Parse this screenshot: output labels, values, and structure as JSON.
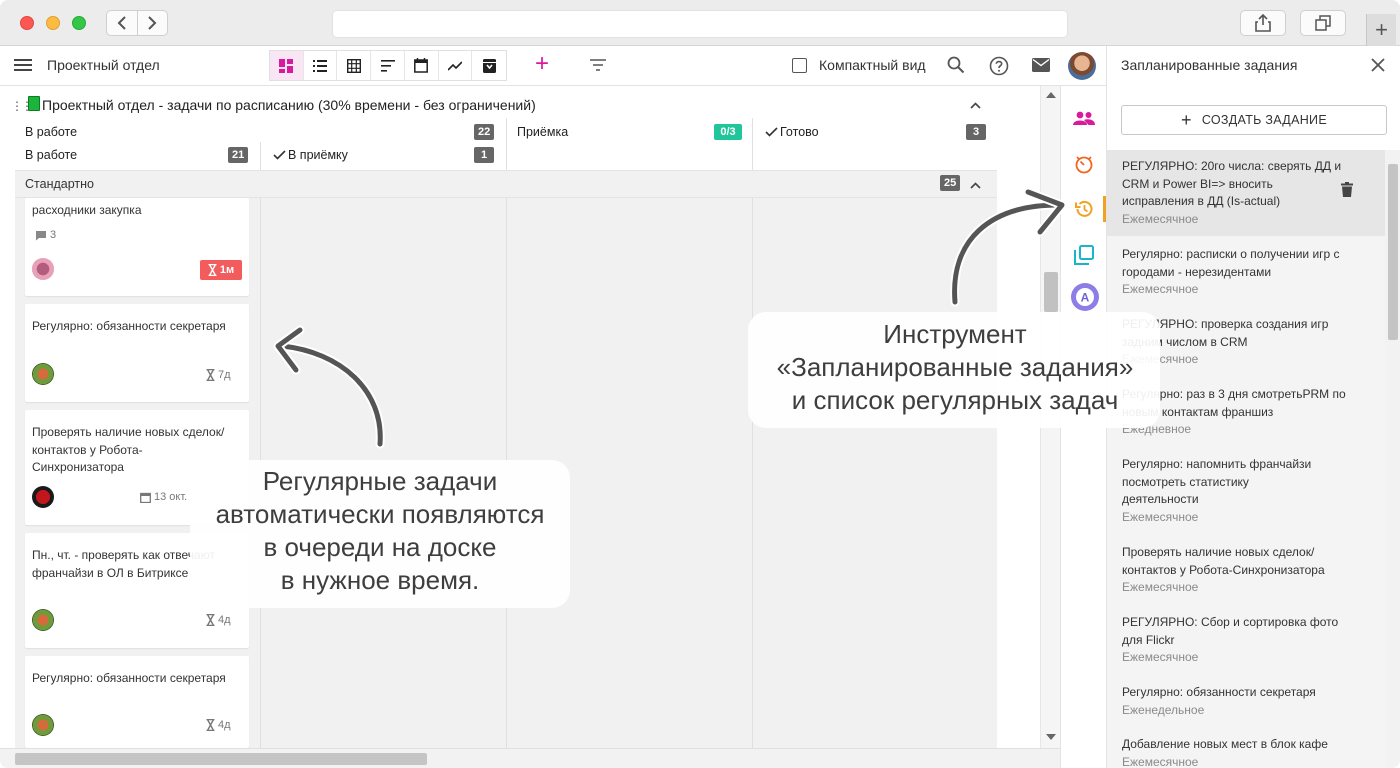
{
  "browser": {
    "back_icon": "chevron-left",
    "forward_icon": "chevron-right"
  },
  "header": {
    "project_title": "Проектный отдел",
    "compact_label": "Компактный вид",
    "accent_color": "#d81b9c"
  },
  "board": {
    "group_title": "Проектный отдел - задачи по расписанию (30% времени - без ограничений)",
    "columns": [
      {
        "title": "В работе",
        "count": "22"
      },
      {
        "title": "Приёмка",
        "count": "0/3"
      },
      {
        "title": "Готово",
        "count": "3"
      }
    ],
    "subcolumns": [
      {
        "title": "В работе",
        "count": "21"
      },
      {
        "title": "В приёмку",
        "count": "1"
      }
    ],
    "swimlane": {
      "title": "Стандартно",
      "count": "25"
    },
    "cards": [
      {
        "title": "расходники закупка",
        "comments": "3",
        "due": "1м"
      },
      {
        "title": "Регулярно: обязанности секретаря",
        "due": "7д"
      },
      {
        "title": "Проверять наличие новых сделок/контактов у Робота-Синхронизатора",
        "date": "13 окт."
      },
      {
        "title": "Пн., чт. - проверять как отвечают франчайзи в ОЛ в Битриксе",
        "due": "4д"
      },
      {
        "title": "Регулярно: обязанности секретаря",
        "due": "4д"
      }
    ]
  },
  "panel": {
    "title": "Запланированные задания",
    "create_label": "СОЗДАТЬ ЗАДАНИЕ",
    "tasks": [
      {
        "title": "РЕГУЛЯРНО: 20го числа: сверять ДД и CRM и Power BI=> вносить исправления в ДД (Is-actual)",
        "period": "Ежемесячное"
      },
      {
        "title": "Регулярно: расписки о получении игр с городами - нерезидентами",
        "period": "Ежемесячное"
      },
      {
        "title": "РЕГУЛЯРНО: проверка создания игр задним числом в CRM",
        "period": "Ежемесячное"
      },
      {
        "title": "Регулярно: раз в 3 дня смотретьPRM по новым контактам франшиз",
        "period": "Ежедневное"
      },
      {
        "title": "Регулярно: напомнить франчайзи посмотреть статистику деятельности",
        "period": "Ежемесячное"
      },
      {
        "title": "Проверять наличие новых сделок/контактов у Робота-Синхронизатора",
        "period": "Ежемесячное"
      },
      {
        "title": "РЕГУЛЯРНО: Сбор и сортировка фото для Flickr",
        "period": "Ежемесячное"
      },
      {
        "title": "Регулярно: обязанности секретаря",
        "period": "Еженедельное"
      },
      {
        "title": "Добавление новых мест в блок кафе",
        "period": "Ежемесячное"
      }
    ]
  },
  "annotations": {
    "left": [
      "Регулярные задачи",
      "автоматически появляются",
      "в очереди на доске",
      "в нужное время."
    ],
    "right": [
      "Инструмент",
      "«Запланированные задания»",
      "и список регулярных задач"
    ]
  }
}
